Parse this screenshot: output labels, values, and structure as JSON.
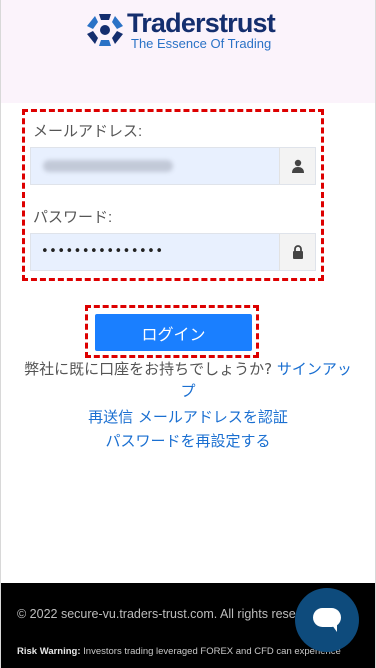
{
  "header": {
    "brand": "Traderstrust",
    "tagline": "The Essence Of Trading"
  },
  "form": {
    "email_label": "メールアドレス:",
    "email_value": "",
    "password_label": "パスワード:",
    "password_value": "•••••••••••••••",
    "email_icon": "user-icon",
    "password_icon": "lock-icon"
  },
  "login": {
    "button_label": "ログイン"
  },
  "links": {
    "account_question": "弊社に既に口座をお持ちでしょうか?",
    "signup": "サインアップ",
    "resend": "再送信 メールアドレスを認証",
    "reset_password": "パスワードを再設定する"
  },
  "footer": {
    "copyright": "© 2022 secure-vu.traders-trust.com. All rights rese",
    "risk_title": "Risk Warning:",
    "risk_text": " Investors trading leveraged FOREX and CFD can experience"
  },
  "colors": {
    "primary": "#1a7fff",
    "highlight": "#dd0000",
    "brand_navy": "#142e6e",
    "brand_blue": "#2a72c6",
    "chat": "#0e4b7c"
  }
}
